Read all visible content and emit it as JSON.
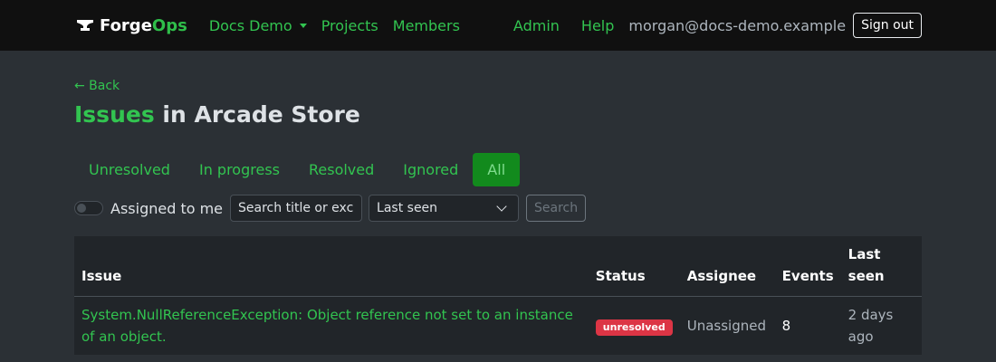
{
  "nav": {
    "brand_part1": "Forge",
    "brand_part2": "Ops",
    "org_dropdown": "Docs Demo",
    "projects": "Projects",
    "members": "Members",
    "admin": "Admin",
    "help": "Help",
    "user_email": "morgan@docs-demo.example",
    "sign_out": "Sign out"
  },
  "page": {
    "back": "← Back",
    "title_accent": "Issues",
    "title_rest": " in Arcade Store"
  },
  "tabs": [
    {
      "label": "Unresolved",
      "active": false
    },
    {
      "label": "In progress",
      "active": false
    },
    {
      "label": "Resolved",
      "active": false
    },
    {
      "label": "Ignored",
      "active": false
    },
    {
      "label": "All",
      "active": true
    }
  ],
  "filters": {
    "assigned_to_me": "Assigned to me",
    "search_placeholder": "Search title or exce",
    "sort_selected": "Last seen",
    "search_button": "Search"
  },
  "table": {
    "headers": [
      "Issue",
      "Status",
      "Assignee",
      "Events",
      "Last seen"
    ],
    "rows": [
      {
        "issue": "System.NullReferenceException: Object reference not set to an instance of an object.",
        "status": "unresolved",
        "assignee": "Unassigned",
        "events": "8",
        "last_seen": "2 days ago"
      }
    ]
  },
  "colors": {
    "accent": "#32c450",
    "navbar_bg": "#101010",
    "page_bg": "#2b3035",
    "status_unresolved": "#dc3545"
  }
}
